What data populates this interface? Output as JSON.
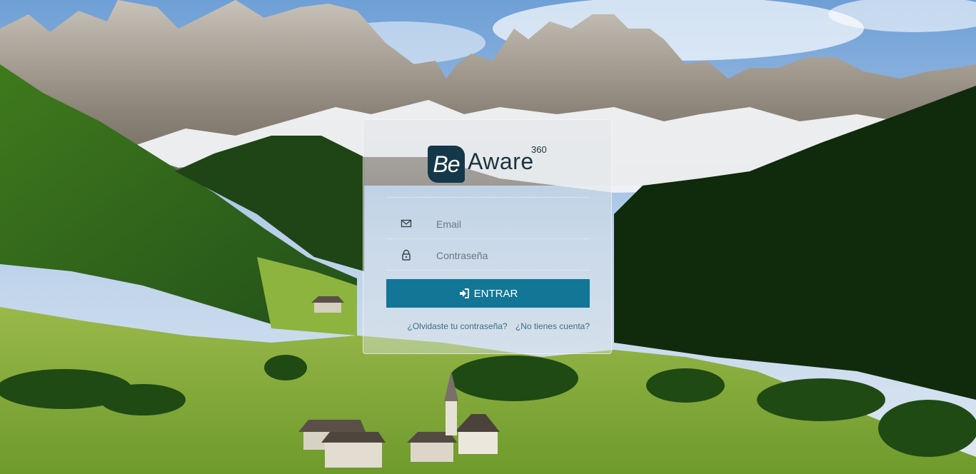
{
  "brand": {
    "prefix": "Be",
    "name": "Aware",
    "suffix": "360"
  },
  "form": {
    "email": {
      "placeholder": "Email",
      "icon": "envelope-icon",
      "value": ""
    },
    "password": {
      "placeholder": "Contraseña",
      "icon": "lock-icon",
      "value": ""
    },
    "submit": {
      "label": "ENTRAR",
      "icon": "sign-in-icon"
    }
  },
  "links": {
    "forgot": "¿Olvidaste tu contraseña?",
    "signup": "¿No tienes cuenta?"
  },
  "colors": {
    "accent": "#137696",
    "logo_dark": "#14384a",
    "link": "#3c6f86"
  }
}
